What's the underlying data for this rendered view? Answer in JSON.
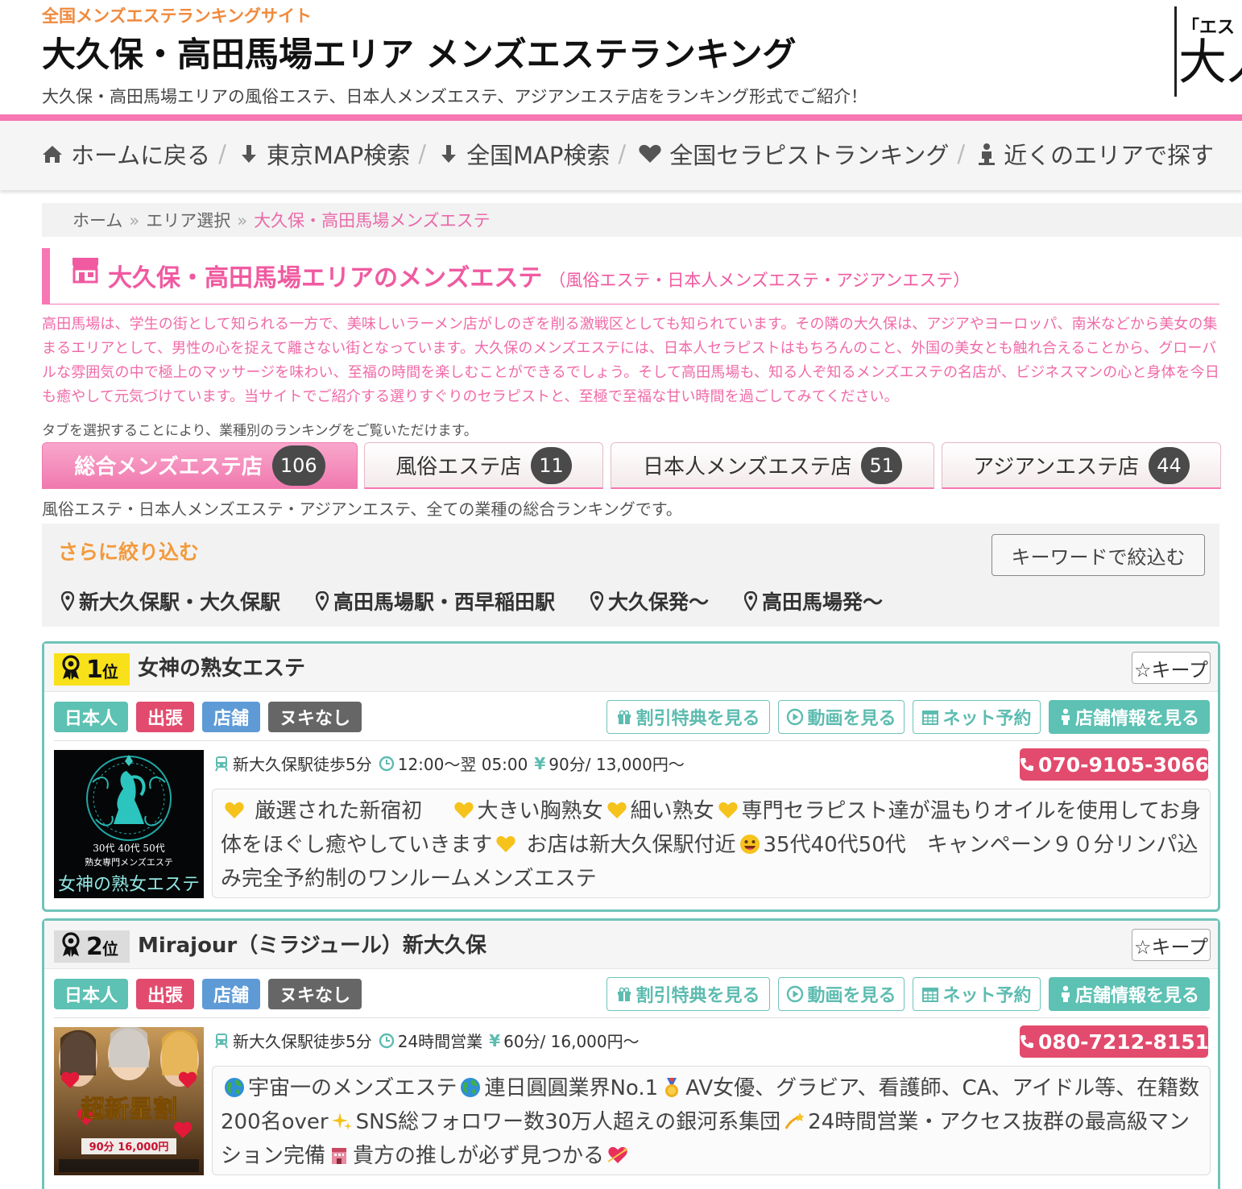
{
  "header": {
    "site_tag": "全国メンズエステランキングサイト",
    "title": "大久保・高田馬場エリア メンズエステランキング",
    "description": "大久保・高田馬場エリアの風俗エステ、日本人メンズエステ、アジアンエステ店をランキング形式でご紹介！",
    "logo_text_top": "「エス",
    "logo_text_big": "大人"
  },
  "nav": {
    "items": [
      {
        "label": "ホームに戻る",
        "icon": "home-icon"
      },
      {
        "label": "東京MAP検索",
        "icon": "arrow-down-icon"
      },
      {
        "label": "全国MAP検索",
        "icon": "arrow-down-icon"
      },
      {
        "label": "全国セラピストランキング",
        "icon": "heart-icon"
      },
      {
        "label": "近くのエリアで探す",
        "icon": "person-icon"
      }
    ],
    "separator": "/"
  },
  "breadcrumb": {
    "items": [
      "ホーム",
      "エリア選択",
      "大久保・高田馬場メンズエステ"
    ],
    "separator": "»"
  },
  "section": {
    "title": "大久保・高田馬場エリアのメンズエステ",
    "subtitle": "（風俗エステ・日本人メンズエステ・アジアンエステ）",
    "intro": "高田馬場は、学生の街として知られる一方で、美味しいラーメン店がしのぎを削る激戦区としても知られています。その隣の大久保は、アジアやヨーロッパ、南米などから美女の集まるエリアとして、男性の心を捉えて離さない街となっています。大久保のメンズエステには、日本人セラピストはもちろんのこと、外国の美女とも触れ合えることから、グローバルな雰囲気の中で極上のマッサージを味わい、至福の時間を楽しむことができるでしょう。そして高田馬場も、知る人ぞ知るメンズエステの名店が、ビジネスマンの心と身体を今日も癒やして元気づけています。当サイトでご紹介する選りすぐりのセラピストと、至極で至福な甘い時間を過ごしてみてください。",
    "tab_hint": "タブを選択することにより、業種別のランキングをご覧いただけます。"
  },
  "tabs": [
    {
      "label": "総合メンズエステ店",
      "count": "106",
      "active": true
    },
    {
      "label": "風俗エステ店",
      "count": "11",
      "active": false
    },
    {
      "label": "日本人メンズエステ店",
      "count": "51",
      "active": false
    },
    {
      "label": "アジアンエステ店",
      "count": "44",
      "active": false
    }
  ],
  "tab_description": "風俗エステ・日本人メンズエステ・アジアンエステ、全ての業種の総合ランキングです。",
  "filter": {
    "title": "さらに絞り込む",
    "keyword_button": "キーワードで絞込む",
    "areas": [
      "新大久保駅・大久保駅",
      "高田馬場駅・西早稲田駅",
      "大久保発～",
      "高田馬場発～"
    ]
  },
  "actions": {
    "discount": "割引特典を見る",
    "video": "動画を見る",
    "reserve": "ネット予約",
    "shop_info": "店舗情報を見る",
    "keep": "☆キープ"
  },
  "listings": [
    {
      "rank": "1",
      "rank_suffix": "位",
      "name": "女神の熟女エステ",
      "tags": [
        "日本人",
        "出張",
        "店舗",
        "ヌキなし"
      ],
      "station": "新大久保駅徒歩5分",
      "hours": "12:00～翌 05:00",
      "price": "90分/ 13,000円～",
      "phone": "070-9105-3066",
      "thumb_caption_1": "30代 40代 50代",
      "thumb_caption_2": "熟女専門メンズエステ",
      "thumb_caption_3": "女神の熟女エステ",
      "pr_parts": [
        "厳選された新宿初　",
        "大きい胸熟女",
        "細い熟女",
        "専門セラピスト達が温もりオイルを使用してお身体をほぐし癒やしていきます",
        "お店は新大久保駅付近",
        "35代40代50代　キャンペーン９０分リンパ込み完全予約制のワンルームメンズエステ"
      ]
    },
    {
      "rank": "2",
      "rank_suffix": "位",
      "name": "Mirajour（ミラジュール）新大久保",
      "tags": [
        "日本人",
        "出張",
        "店舗",
        "ヌキなし"
      ],
      "station": "新大久保駅徒歩5分",
      "hours": "24時間営業",
      "price": "60分/ 16,000円～",
      "phone": "080-7212-8151",
      "thumb_caption_1": "超新星割",
      "thumb_caption_2": "90分 16,000円",
      "pr_parts": [
        "宇宙一のメンズエステ",
        "連日圓圓業界No.1",
        "AV女優、グラビア、看護師、CA、アイドル等、在籍数200名over",
        "SNS総フォロワー数30万人超えの銀河系集団",
        "24時間営業・アクセス抜群の最高級マンション完備",
        "貴方の推しが必ず見つかる"
      ]
    }
  ],
  "colors": {
    "pink": "#f777b3",
    "teal": "#5dc1b3",
    "red": "#e24b6d",
    "orange": "#f29a3c"
  }
}
